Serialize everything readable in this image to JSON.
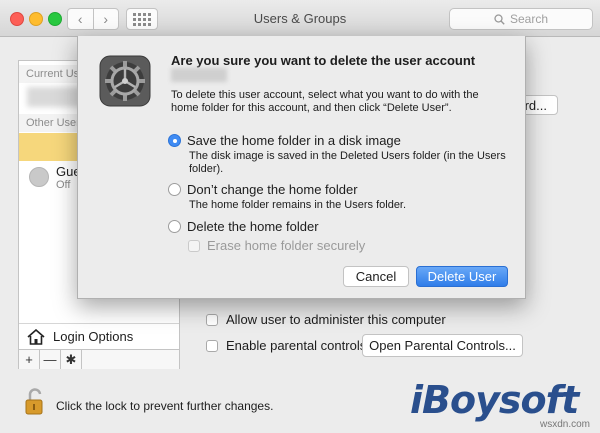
{
  "window": {
    "title": "Users & Groups"
  },
  "toolbar": {
    "search_placeholder": "Search",
    "back_glyph": "‹",
    "forward_glyph": "›"
  },
  "sidebar": {
    "current_header": "Current Us",
    "other_header": "Other User",
    "guest_name": "Gue",
    "guest_status": "Off",
    "login_options": "Login Options",
    "add_glyph": "+",
    "remove_glyph": "—",
    "gear_glyph": "✱"
  },
  "pane": {
    "password_button": "ord...",
    "admin_checkbox": "Allow user to administer this computer",
    "parental_checkbox": "Enable parental controls",
    "parental_button": "Open Parental Controls...",
    "lock_text": "Click the lock to prevent further changes."
  },
  "dialog": {
    "title": "Are you sure you want to delete the user account",
    "message": "To delete this user account, select what you want to do with the home folder for this account, and then click “Delete User”.",
    "options": [
      {
        "label": "Save the home folder in a disk image",
        "selected": true,
        "description": "The disk image is saved in the Deleted Users folder (in the Users folder)."
      },
      {
        "label": "Don’t change the home folder",
        "selected": false,
        "description": "The home folder remains in the Users folder."
      },
      {
        "label": "Delete the home folder",
        "selected": false,
        "description": ""
      }
    ],
    "erase_option": "Erase home folder securely",
    "cancel_label": "Cancel",
    "delete_label": "Delete User"
  },
  "watermark": {
    "brand": "iBoysoft",
    "site": "wsxdn.com"
  },
  "colors": {
    "accent": "#3f8bf3",
    "brand": "#2a4f8d",
    "highlight": "#f6d77c"
  }
}
